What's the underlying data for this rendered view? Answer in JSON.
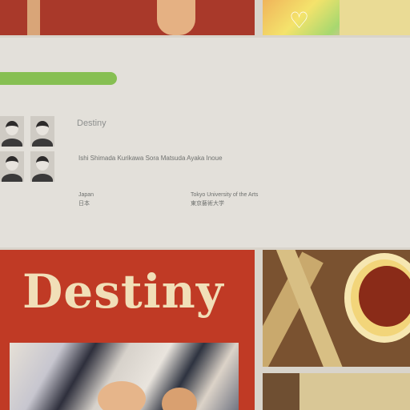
{
  "top_strip": {
    "red_panel_caption": "",
    "art_panel_icon": "heart-icon"
  },
  "info_card": {
    "category_tab": "",
    "subcategory": "",
    "work_title": "Destiny",
    "creators_label": "",
    "creators_names": "Ishi Shimada  Kurikawa  Sora Matsuda  Ayaka Inoue",
    "country_label": "",
    "country_value": "Japan",
    "country_value_jp": "日本",
    "school_label": "",
    "school_value": "Tokyo University of the Arts",
    "school_value_jp": "東京藝術大学",
    "category_color": "#86bf52"
  },
  "poster": {
    "title": "Destiny",
    "background_color": "#c03a25"
  }
}
